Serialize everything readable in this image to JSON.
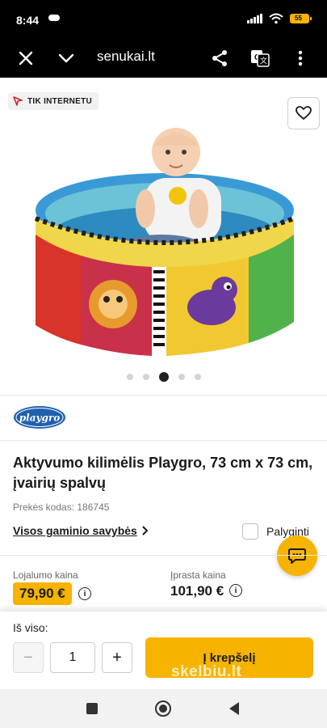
{
  "status": {
    "time": "8:44",
    "battery": "55"
  },
  "browser": {
    "url": "senukai.lt"
  },
  "product": {
    "badge": "TIK INTERNETU",
    "brand": "playgro",
    "title": "Aktyvumo kilimėlis Playgro, 73 cm x 73 cm, įvairių spalvų",
    "sku_label": "Prekės kodas: 186745",
    "properties_link": "Visos gaminio savybės",
    "compare_label": "Palyginti",
    "image_count": 5,
    "active_image": 3
  },
  "pricing": {
    "loyalty_label": "Lojalumo kaina",
    "loyalty_price": "79,90 €",
    "regular_label": "Įprasta kaina",
    "regular_price": "101,90 €"
  },
  "cart": {
    "total_label": "Iš viso:",
    "quantity": "1",
    "minus": "−",
    "plus": "+",
    "button_label": "Į krepšelį"
  },
  "watermark": "skelbiu.lt",
  "colors": {
    "accent": "#f6b400",
    "dark": "#000000"
  }
}
